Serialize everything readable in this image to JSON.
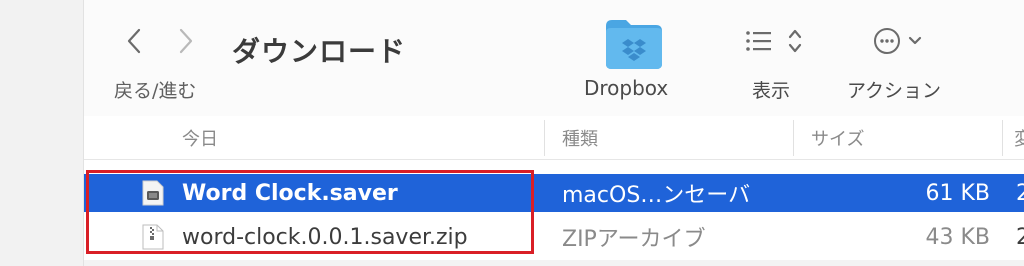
{
  "toolbar": {
    "nav_label": "戻る/進む",
    "title": "ダウンロード",
    "dropbox_label": "Dropbox",
    "view_label": "表示",
    "action_label": "アクション"
  },
  "columns": {
    "name": "今日",
    "kind": "種類",
    "size": "サイズ",
    "extra": "変"
  },
  "files": [
    {
      "name": "Word Clock.saver",
      "kind": "macOS…ンセーバ",
      "size": "61 KB",
      "extra": "2",
      "selected": true
    },
    {
      "name": "word-clock.0.0.1.saver.zip",
      "kind": "ZIPアーカイブ",
      "size": "43 KB",
      "extra": "2",
      "selected": false
    }
  ],
  "colors": {
    "selection": "#1f63d9",
    "highlight_box": "#d91f26",
    "folder_blue": "#5ab2ea"
  }
}
